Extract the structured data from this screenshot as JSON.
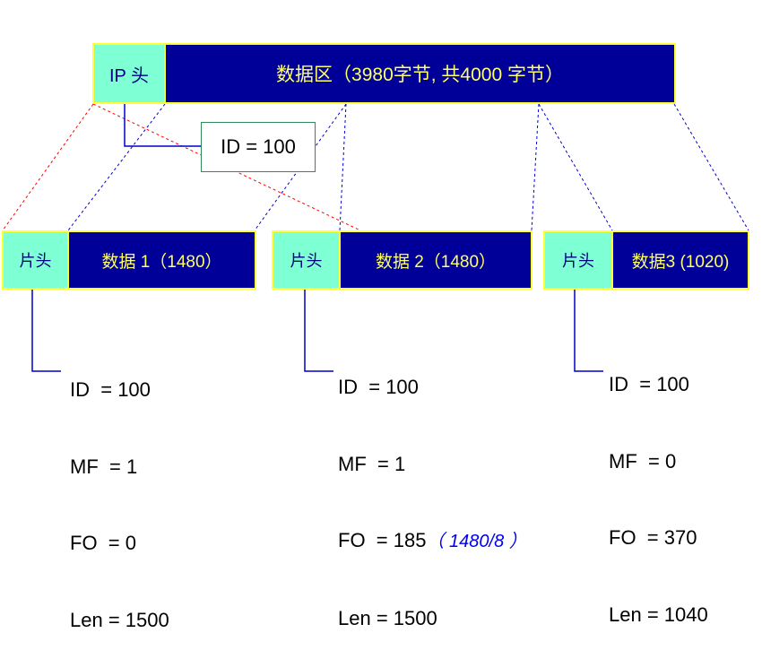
{
  "original": {
    "header_label": "IP 头",
    "data_label": "数据区（3980字节, 共4000 字节）",
    "id_label": "ID = 100"
  },
  "fragments": [
    {
      "header_label": "片头",
      "data_label": "数据 1（1480）",
      "fields": [
        {
          "name": "ID",
          "sep": "  = ",
          "value": "100"
        },
        {
          "name": "MF",
          "sep": "  = ",
          "value": "1"
        },
        {
          "name": "FO",
          "sep": "  = ",
          "value": "0"
        },
        {
          "name": "Len",
          "sep": " = ",
          "value": "1500"
        }
      ]
    },
    {
      "header_label": "片头",
      "data_label": "数据 2（1480）",
      "fields": [
        {
          "name": "ID",
          "sep": "  = ",
          "value": "100"
        },
        {
          "name": "MF",
          "sep": "  = ",
          "value": "1"
        },
        {
          "name": "FO",
          "sep": "  = ",
          "value": "185",
          "note": "（ 1480/8 ）"
        },
        {
          "name": "Len",
          "sep": " = ",
          "value": "1500"
        }
      ]
    },
    {
      "header_label": "片头",
      "data_label": "数据3 (1020)",
      "fields": [
        {
          "name": "ID",
          "sep": "  = ",
          "value": "100"
        },
        {
          "name": "MF",
          "sep": "  = ",
          "value": "0"
        },
        {
          "name": "FO",
          "sep": "  = ",
          "value": "370"
        },
        {
          "name": "Len",
          "sep": " = ",
          "value": "1040"
        }
      ]
    }
  ],
  "colors": {
    "header_fill": "#7fffd4",
    "data_fill": "#000099",
    "border": "#ffff33",
    "header_connector": "#ff0000",
    "data_connector": "#0000cc"
  }
}
